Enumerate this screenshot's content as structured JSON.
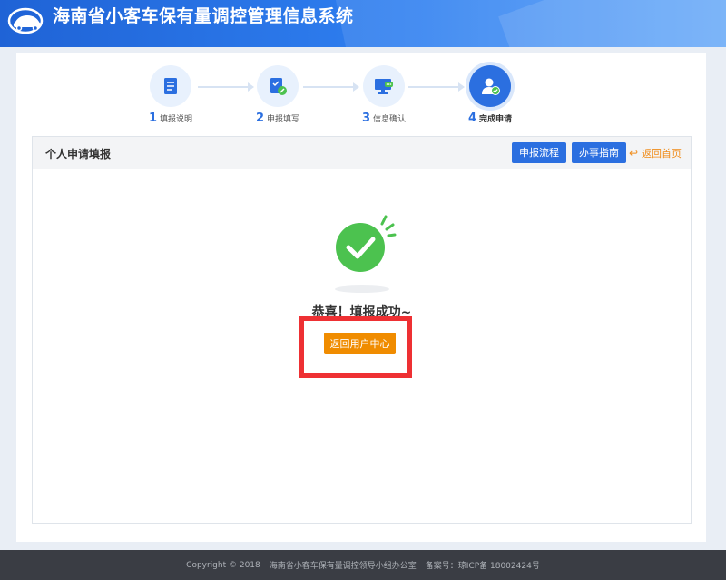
{
  "header": {
    "title": "海南省小客车保有量调控管理信息系统"
  },
  "stepper": {
    "steps": [
      {
        "num": "1",
        "label": "填报说明",
        "icon": "document-icon"
      },
      {
        "num": "2",
        "label": "申报填写",
        "icon": "edit-check-icon"
      },
      {
        "num": "3",
        "label": "信息确认",
        "icon": "monitor-chat-icon"
      },
      {
        "num": "4",
        "label": "完成申请",
        "icon": "user-check-icon"
      }
    ],
    "active_step": 4
  },
  "panel": {
    "title": "个人申请填报",
    "btn_flow": "申报流程",
    "btn_guide": "办事指南",
    "back_home": "返回首页"
  },
  "success": {
    "message": "恭喜！填报成功~",
    "button_label": "返回用户中心"
  },
  "footer": {
    "copyright": "Copyright  © 2018",
    "org": "海南省小客车保有量调控领导小组办公室",
    "icp": "备案号：琼ICP备 18002424号"
  },
  "colors": {
    "brand_blue": "#2b6fe0",
    "accent_orange": "#f08c00",
    "success_green": "#4cc24f",
    "highlight_red": "#ee3033"
  }
}
